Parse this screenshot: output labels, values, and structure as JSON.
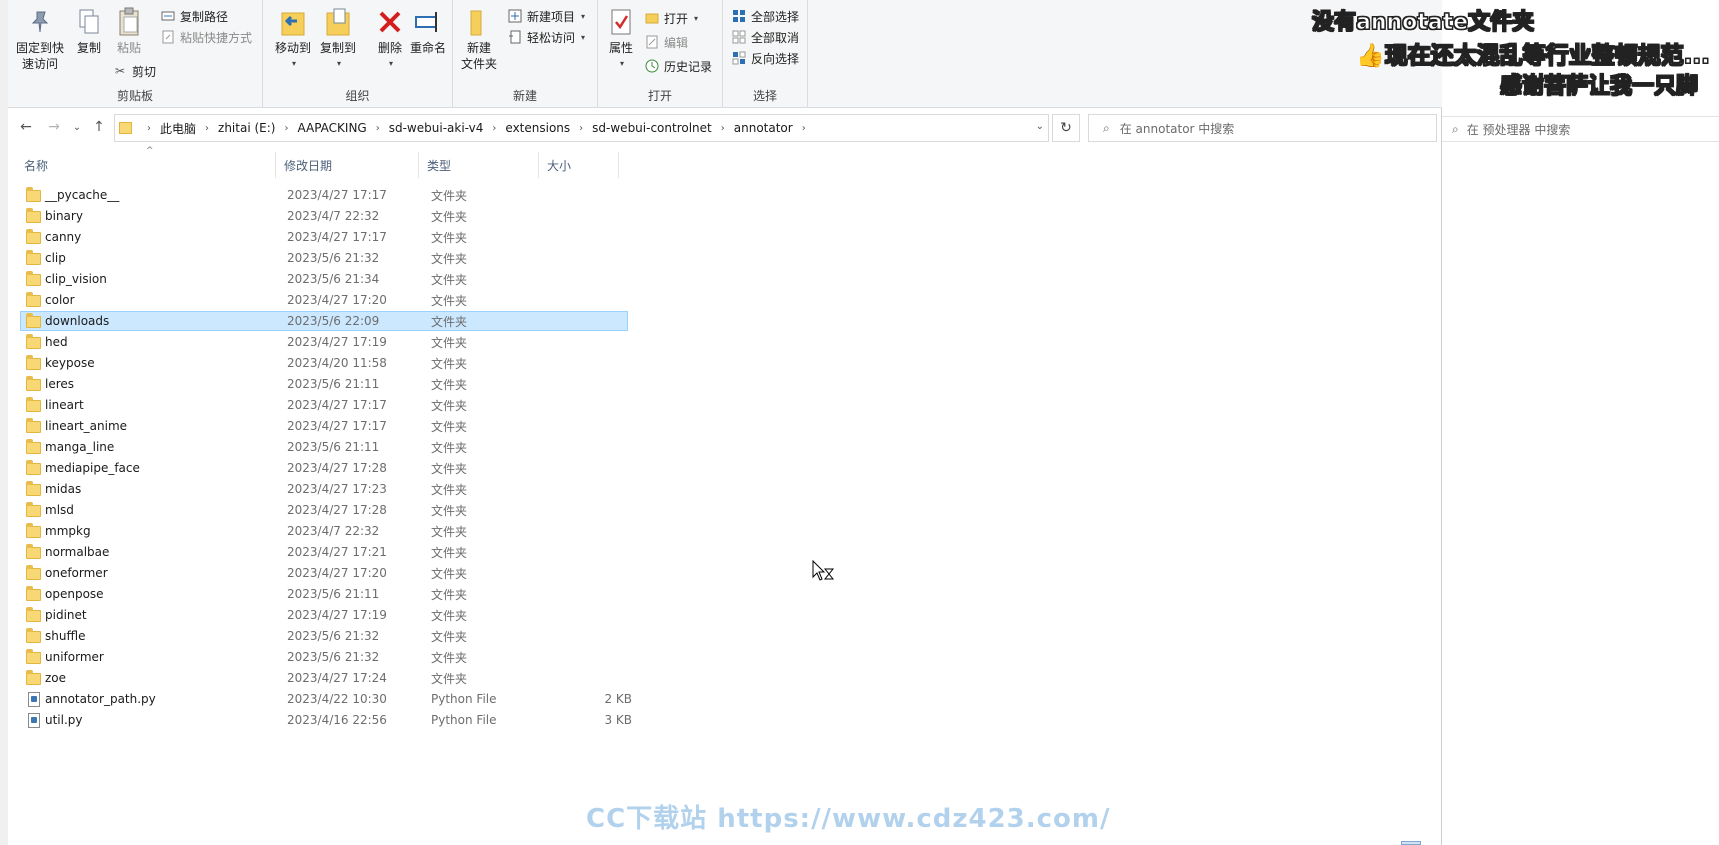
{
  "ribbon": {
    "clipboard": {
      "pin_label_1": "固定到快",
      "pin_label_2": "速访问",
      "copy": "复制",
      "paste": "粘贴",
      "copy_path": "复制路径",
      "paste_shortcut": "粘贴快捷方式",
      "cut": "剪切",
      "group": "剪贴板"
    },
    "organize": {
      "move_to": "移动到",
      "copy_to": "复制到",
      "delete": "删除",
      "rename": "重命名",
      "group": "组织"
    },
    "new": {
      "new_folder_1": "新建",
      "new_folder_2": "文件夹",
      "new_item": "新建项目",
      "easy_access": "轻松访问",
      "group": "新建"
    },
    "open": {
      "properties": "属性",
      "open": "打开",
      "edit": "编辑",
      "history": "历史记录",
      "group": "打开"
    },
    "select": {
      "select_all": "全部选择",
      "select_none": "全部取消",
      "invert": "反向选择",
      "group": "选择"
    }
  },
  "address": {
    "crumbs": [
      "此电脑",
      "zhitai (E:)",
      "AAPACKING",
      "sd-webui-aki-v4",
      "extensions",
      "sd-webui-controlnet",
      "annotator"
    ],
    "search_placeholder": "在 annotator 中搜索"
  },
  "columns": {
    "name": "名称",
    "date": "修改日期",
    "type": "类型",
    "size": "大小"
  },
  "files": [
    {
      "name": "__pycache__",
      "date": "2023/4/27 17:17",
      "type": "文件夹",
      "size": "",
      "kind": "folder"
    },
    {
      "name": "binary",
      "date": "2023/4/7 22:32",
      "type": "文件夹",
      "size": "",
      "kind": "folder"
    },
    {
      "name": "canny",
      "date": "2023/4/27 17:17",
      "type": "文件夹",
      "size": "",
      "kind": "folder"
    },
    {
      "name": "clip",
      "date": "2023/5/6 21:32",
      "type": "文件夹",
      "size": "",
      "kind": "folder"
    },
    {
      "name": "clip_vision",
      "date": "2023/5/6 21:34",
      "type": "文件夹",
      "size": "",
      "kind": "folder"
    },
    {
      "name": "color",
      "date": "2023/4/27 17:20",
      "type": "文件夹",
      "size": "",
      "kind": "folder"
    },
    {
      "name": "downloads",
      "date": "2023/5/6 22:09",
      "type": "文件夹",
      "size": "",
      "kind": "folder",
      "selected": true
    },
    {
      "name": "hed",
      "date": "2023/4/27 17:19",
      "type": "文件夹",
      "size": "",
      "kind": "folder"
    },
    {
      "name": "keypose",
      "date": "2023/4/20 11:58",
      "type": "文件夹",
      "size": "",
      "kind": "folder"
    },
    {
      "name": "leres",
      "date": "2023/5/6 21:11",
      "type": "文件夹",
      "size": "",
      "kind": "folder"
    },
    {
      "name": "lineart",
      "date": "2023/4/27 17:17",
      "type": "文件夹",
      "size": "",
      "kind": "folder"
    },
    {
      "name": "lineart_anime",
      "date": "2023/4/27 17:17",
      "type": "文件夹",
      "size": "",
      "kind": "folder"
    },
    {
      "name": "manga_line",
      "date": "2023/5/6 21:11",
      "type": "文件夹",
      "size": "",
      "kind": "folder"
    },
    {
      "name": "mediapipe_face",
      "date": "2023/4/27 17:28",
      "type": "文件夹",
      "size": "",
      "kind": "folder"
    },
    {
      "name": "midas",
      "date": "2023/4/27 17:23",
      "type": "文件夹",
      "size": "",
      "kind": "folder"
    },
    {
      "name": "mlsd",
      "date": "2023/4/27 17:28",
      "type": "文件夹",
      "size": "",
      "kind": "folder"
    },
    {
      "name": "mmpkg",
      "date": "2023/4/7 22:32",
      "type": "文件夹",
      "size": "",
      "kind": "folder"
    },
    {
      "name": "normalbae",
      "date": "2023/4/27 17:21",
      "type": "文件夹",
      "size": "",
      "kind": "folder"
    },
    {
      "name": "oneformer",
      "date": "2023/4/27 17:20",
      "type": "文件夹",
      "size": "",
      "kind": "folder"
    },
    {
      "name": "openpose",
      "date": "2023/5/6 21:11",
      "type": "文件夹",
      "size": "",
      "kind": "folder"
    },
    {
      "name": "pidinet",
      "date": "2023/4/27 17:19",
      "type": "文件夹",
      "size": "",
      "kind": "folder"
    },
    {
      "name": "shuffle",
      "date": "2023/5/6 21:32",
      "type": "文件夹",
      "size": "",
      "kind": "folder"
    },
    {
      "name": "uniformer",
      "date": "2023/5/6 21:32",
      "type": "文件夹",
      "size": "",
      "kind": "folder"
    },
    {
      "name": "zoe",
      "date": "2023/4/27 17:24",
      "type": "文件夹",
      "size": "",
      "kind": "folder"
    },
    {
      "name": "annotator_path.py",
      "date": "2023/4/22 10:30",
      "type": "Python File",
      "size": "2 KB",
      "kind": "py"
    },
    {
      "name": "util.py",
      "date": "2023/4/16 22:56",
      "type": "Python File",
      "size": "3 KB",
      "kind": "py"
    }
  ],
  "background_window": {
    "search_placeholder": "在 预处理器 中搜索"
  },
  "overlay": {
    "line1": "没有annotate文件夹",
    "line2": "现在还太混乱等行业整顿规范...",
    "line3": "感谢菩萨让我一只脚",
    "watermark": "CC下载站 https://www.cdz423.com/"
  },
  "colors": {
    "selection": "#cce8ff",
    "folder": "#f8d775",
    "header_text": "#4c607a"
  }
}
